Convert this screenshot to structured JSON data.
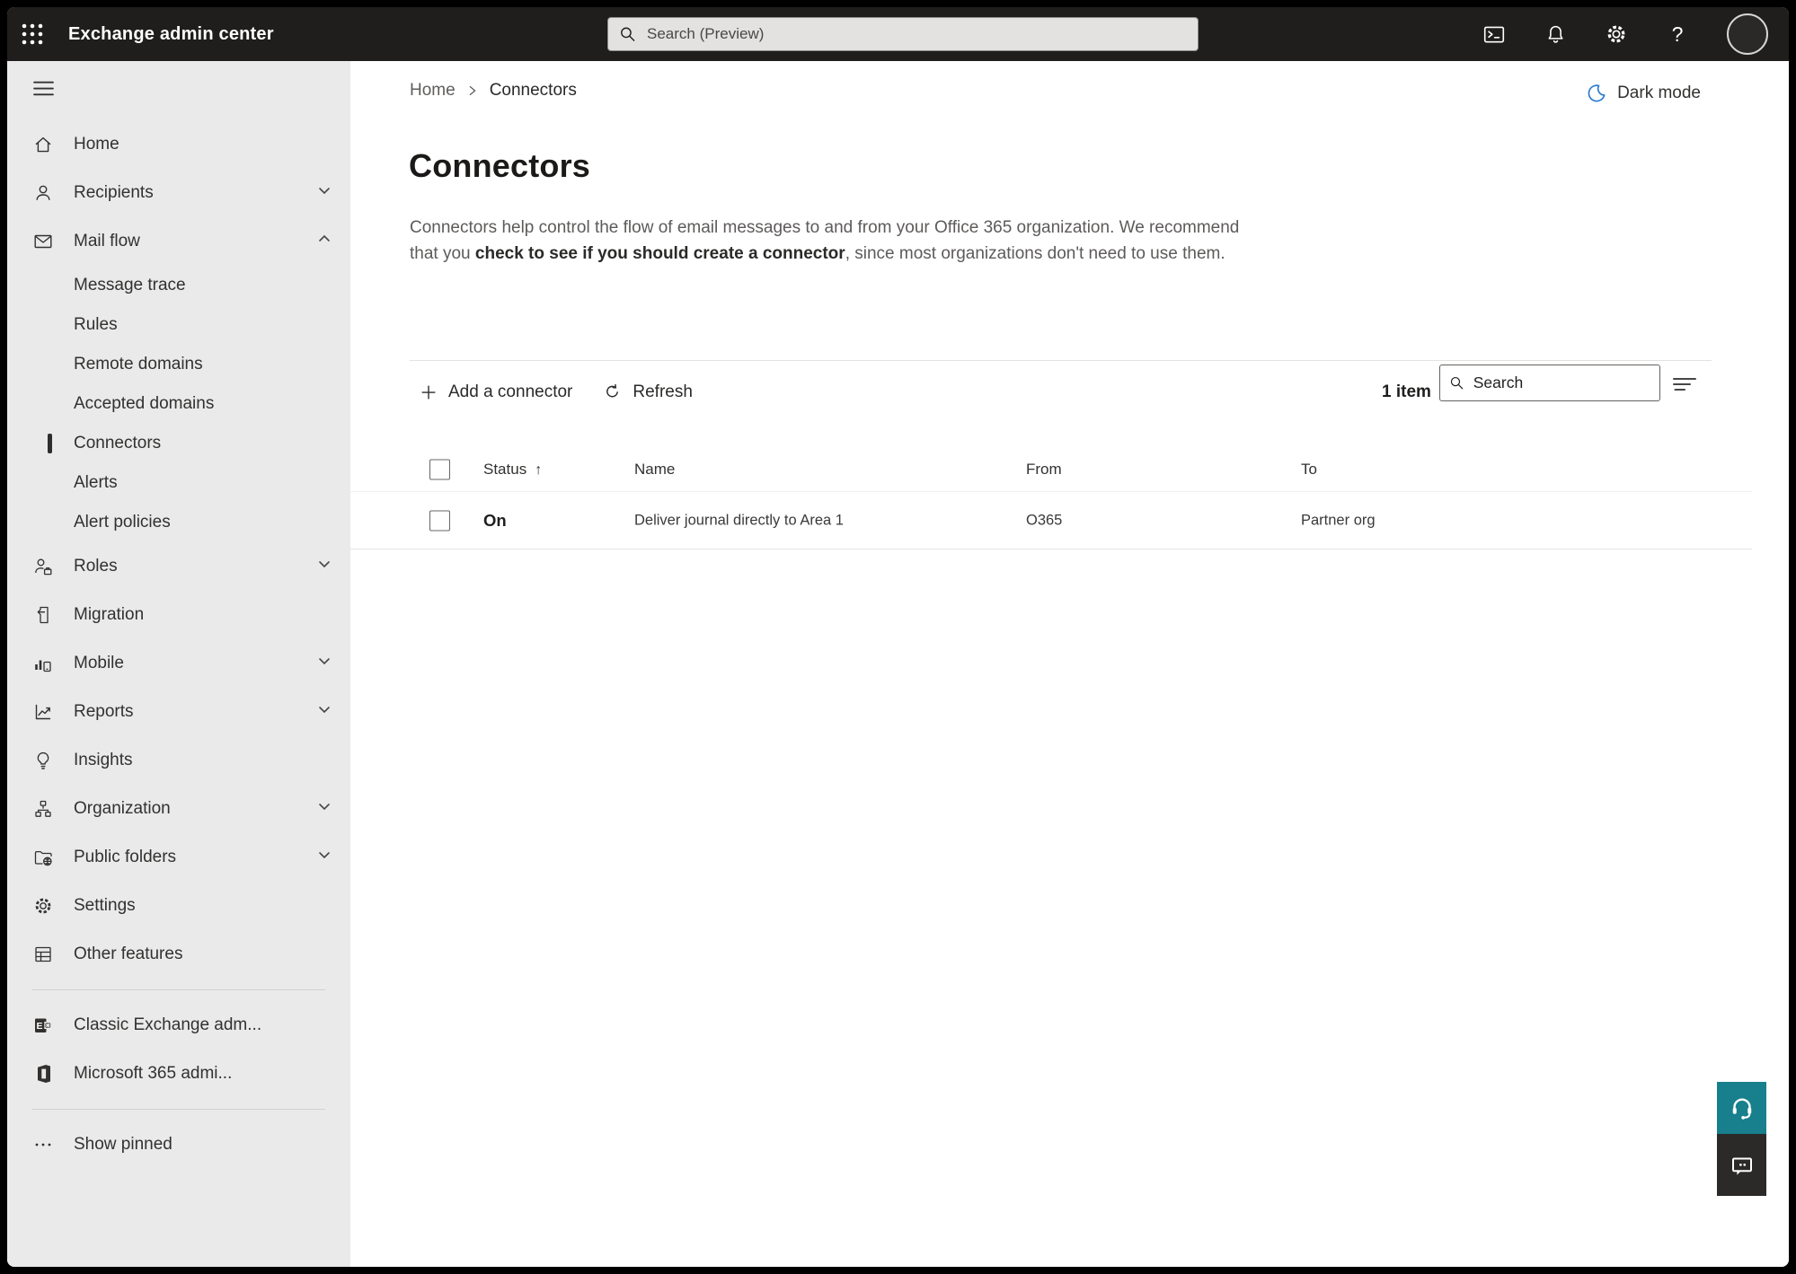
{
  "topbar": {
    "app_title": "Exchange admin center",
    "search_placeholder": "Search (Preview)",
    "icons": [
      "app-launcher-icon",
      "terminal-icon",
      "bell-icon",
      "gear-icon",
      "help-icon",
      "account-avatar"
    ]
  },
  "sidebar": {
    "items": [
      {
        "label": "Home"
      },
      {
        "label": "Recipients"
      },
      {
        "label": "Mail flow"
      },
      {
        "label": "Message trace"
      },
      {
        "label": "Rules"
      },
      {
        "label": "Remote domains"
      },
      {
        "label": "Accepted domains"
      },
      {
        "label": "Connectors"
      },
      {
        "label": "Alerts"
      },
      {
        "label": "Alert policies"
      },
      {
        "label": "Roles"
      },
      {
        "label": "Migration"
      },
      {
        "label": "Mobile"
      },
      {
        "label": "Reports"
      },
      {
        "label": "Insights"
      },
      {
        "label": "Organization"
      },
      {
        "label": "Public folders"
      },
      {
        "label": "Settings"
      },
      {
        "label": "Other features"
      },
      {
        "label": "Classic Exchange adm..."
      },
      {
        "label": "Microsoft 365 admi..."
      },
      {
        "label": "Show pinned"
      }
    ],
    "selected_item": "Connectors"
  },
  "breadcrumb": {
    "home": "Home",
    "current": "Connectors"
  },
  "darkmode": {
    "label": "Dark mode"
  },
  "page": {
    "title": "Connectors",
    "desc_part1": "Connectors help control the flow of email messages to and from your Office 365 organization. We recommend that you ",
    "desc_link": "check to see if you should create a connector",
    "desc_part2": ", since most organizations don't need to use them."
  },
  "toolbar": {
    "add_label": "Add a connector",
    "refresh_label": "Refresh",
    "item_count": "1 item",
    "search_placeholder": "Search"
  },
  "table": {
    "columns": [
      "Status",
      "Name",
      "From",
      "To"
    ],
    "sort_column": "Status",
    "sort_direction": "ascending",
    "rows": [
      {
        "status": "On",
        "name": "Deliver journal directly to Area 1",
        "from": "O365",
        "to": "Partner org"
      }
    ]
  },
  "colors": {
    "topbar_bg": "#1f1e1d",
    "sidebar_bg": "#eaeaea",
    "accent_teal": "#18808d",
    "feedback_dark": "#2b2a29",
    "moon_blue": "#2b7cd3"
  }
}
